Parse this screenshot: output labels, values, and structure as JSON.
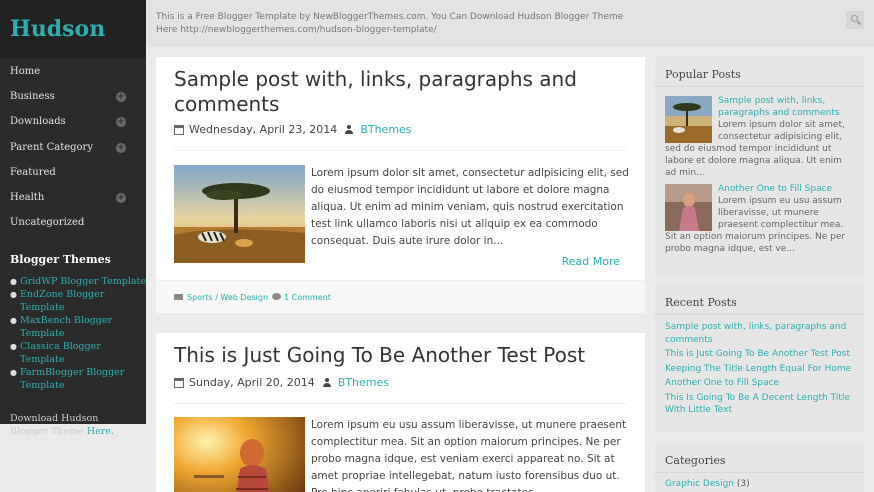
{
  "sidebar": {
    "logo": "Hudson",
    "nav": [
      {
        "label": "Home",
        "expand": false
      },
      {
        "label": "Business",
        "expand": true
      },
      {
        "label": "Downloads",
        "expand": true
      },
      {
        "label": "Parent Category",
        "expand": true
      },
      {
        "label": "Featured",
        "expand": false
      },
      {
        "label": "Health",
        "expand": true
      },
      {
        "label": "Uncategorized",
        "expand": false
      }
    ],
    "blogger_themes_title": "Blogger Themes",
    "blogger_themes": [
      "GridWP Blogger Template",
      "EndZone Blogger Template",
      "MaxBench Blogger Template",
      "Classica Blogger Template",
      "FarmBlogger Blogger Template"
    ],
    "download_text": "Download Hudson Blogger Theme",
    "download_link": "Here."
  },
  "topbar": {
    "message": "This is a Free Blogger Template by NewBloggerThemes.com. You Can Download Hudson Blogger Theme Here http://newbloggerthemes.com/hudson-blogger-template/",
    "search_icon": "search-icon"
  },
  "posts": [
    {
      "title": "Sample post with, links, paragraphs and comments",
      "date": "Wednesday, April 23, 2014",
      "author": "BThemes",
      "excerpt": "Lorem ipsum dolor sit amet, consectetur adipisicing elit, sed do eiusmod tempor incididunt ut labore et dolore magna aliqua. Ut enim ad minim veniam, quis nostrud exercitation test link ullamco laboris nisi ut aliquip ex ea commodo consequat. Duis aute irure dolor in...",
      "read_more": "Read More",
      "labels": "Sports / Web Design",
      "comments": "1 Comment"
    },
    {
      "title": "This is Just Going To Be Another Test Post",
      "date": "Sunday, April 20, 2014",
      "author": "BThemes",
      "excerpt": "Lorem ipsum eu usu assum liberavisse, ut munere praesent complectitur mea. Sit an option maiorum principes. Ne per probo magna idque, est veniam exerci appareat no. Sit at amet propriae intellegebat, natum iusto forensibus duo ut. Pro hinc aperiri fabulas ut, probo tractatos"
    }
  ],
  "popular_posts": {
    "title": "Popular Posts",
    "items": [
      {
        "title": "Sample post with, links, paragraphs and comments",
        "snippet": "Lorem ipsum dolor sit amet, consectetur adipisicing elit, sed do eiusmod tempor incididunt ut labore et dolore magna aliqua. Ut enim ad min..."
      },
      {
        "title": "Another One to Fill Space",
        "snippet": "Lorem ipsum eu usu assum liberavisse, ut munere praesent complectitur mea. Sit an option maiorum principes. Ne per probo magna idque, est ve..."
      }
    ]
  },
  "recent_posts": {
    "title": "Recent Posts",
    "items": [
      "Sample post with, links, paragraphs and comments",
      "This is Just Going To Be Another Test Post",
      "Keeping The Title Length Equal For Home",
      "Another One to Fill Space",
      "This Is Going To Be A Decent Length Title With Little Text"
    ]
  },
  "categories": {
    "title": "Categories",
    "first_name": "Graphic Design",
    "first_count": "(3)"
  },
  "colors": {
    "accent": "#2ab0b0",
    "sidebar": "#2b2b2b",
    "background": "#ebebeb"
  }
}
